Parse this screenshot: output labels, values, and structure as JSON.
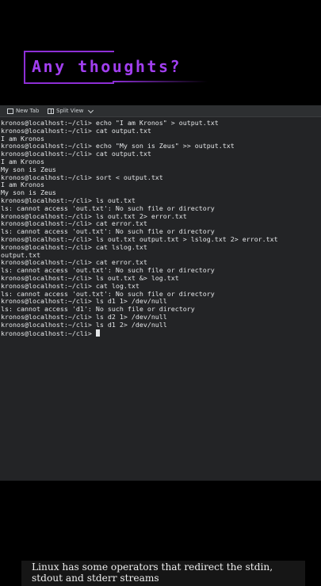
{
  "banner": {
    "title": "Any thoughts?"
  },
  "toolbar": {
    "new_tab": "New Tab",
    "split_view": "Split View"
  },
  "terminal": {
    "lines": [
      "kronos@localhost:~/cli> echo \"I am Kronos\" > output.txt",
      "kronos@localhost:~/cli> cat output.txt",
      "I am Kronos",
      "kronos@localhost:~/cli> echo \"My son is Zeus\" >> output.txt",
      "kronos@localhost:~/cli> cat output.txt",
      "I am Kronos",
      "My son is Zeus",
      "kronos@localhost:~/cli> sort < output.txt",
      "I am Kronos",
      "My son is Zeus",
      "kronos@localhost:~/cli> ls out.txt",
      "ls: cannot access 'out.txt': No such file or directory",
      "kronos@localhost:~/cli> ls out.txt 2> error.txt",
      "kronos@localhost:~/cli> cat error.txt",
      "ls: cannot access 'out.txt': No such file or directory",
      "kronos@localhost:~/cli> ls out.txt output.txt > lslog.txt 2> error.txt",
      "kronos@localhost:~/cli> cat lslog.txt",
      "output.txt",
      "kronos@localhost:~/cli> cat error.txt",
      "ls: cannot access 'out.txt': No such file or directory",
      "kronos@localhost:~/cli> ls out.txt &> log.txt",
      "kronos@localhost:~/cli> cat log.txt",
      "ls: cannot access 'out.txt': No such file or directory",
      "kronos@localhost:~/cli> ls d1 1> /dev/null",
      "ls: cannot access 'd1': No such file or directory",
      "kronos@localhost:~/cli> ls d2 1> /dev/null",
      "kronos@localhost:~/cli> ls d1 2> /dev/null"
    ],
    "prompt": "kronos@localhost:~/cli> "
  },
  "caption": {
    "text": "Linux has some operators that redirect the stdin, stdout and stderr streams"
  }
}
